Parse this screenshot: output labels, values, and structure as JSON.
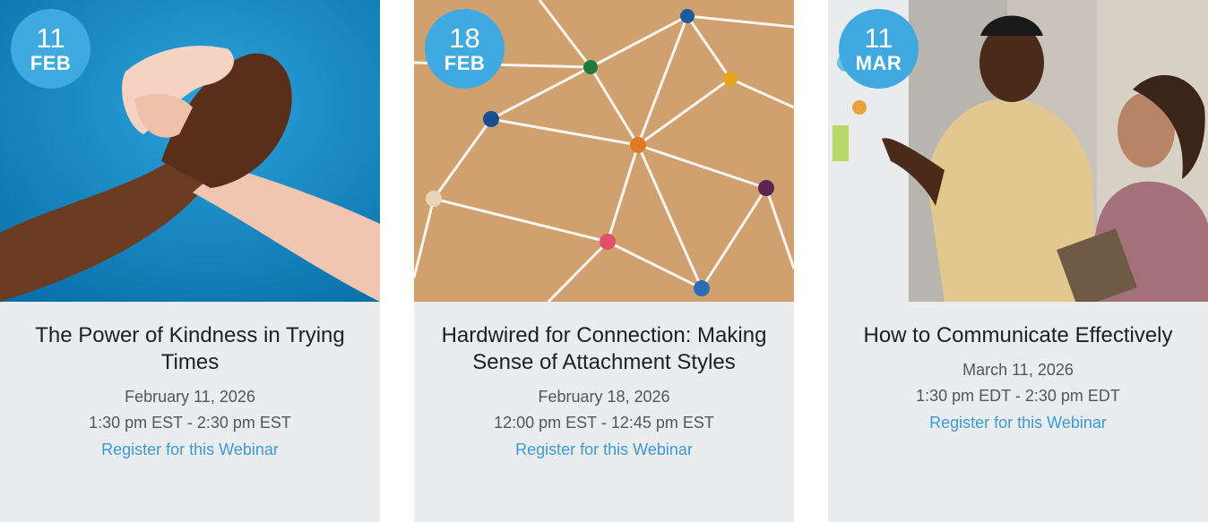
{
  "events": [
    {
      "badge": {
        "day": "11",
        "month": "FEB"
      },
      "image": "handshake-photo",
      "title": "The Power of Kindness in Trying Times",
      "date": "February 11, 2026",
      "time": "1:30 pm EST - 2:30 pm EST",
      "link": "Register for this Webinar"
    },
    {
      "badge": {
        "day": "18",
        "month": "FEB"
      },
      "image": "pin-network-photo",
      "title": "Hardwired for Connection: Making Sense of Attachment Styles",
      "date": "February 18, 2026",
      "time": "12:00 pm EST - 12:45 pm EST",
      "link": "Register for this Webinar"
    },
    {
      "badge": {
        "day": "11",
        "month": "MAR"
      },
      "image": "office-conversation-photo",
      "title": "How to Communicate Effectively",
      "date": "March 11, 2026",
      "time": "1:30 pm EDT - 2:30 pm EDT",
      "link": "Register for this Webinar"
    }
  ],
  "colors": {
    "accent": "#3fa9e0",
    "link": "#3a9bd6",
    "card_bg": "#ebecee",
    "title": "#1f1f1f",
    "meta": "#555555"
  }
}
